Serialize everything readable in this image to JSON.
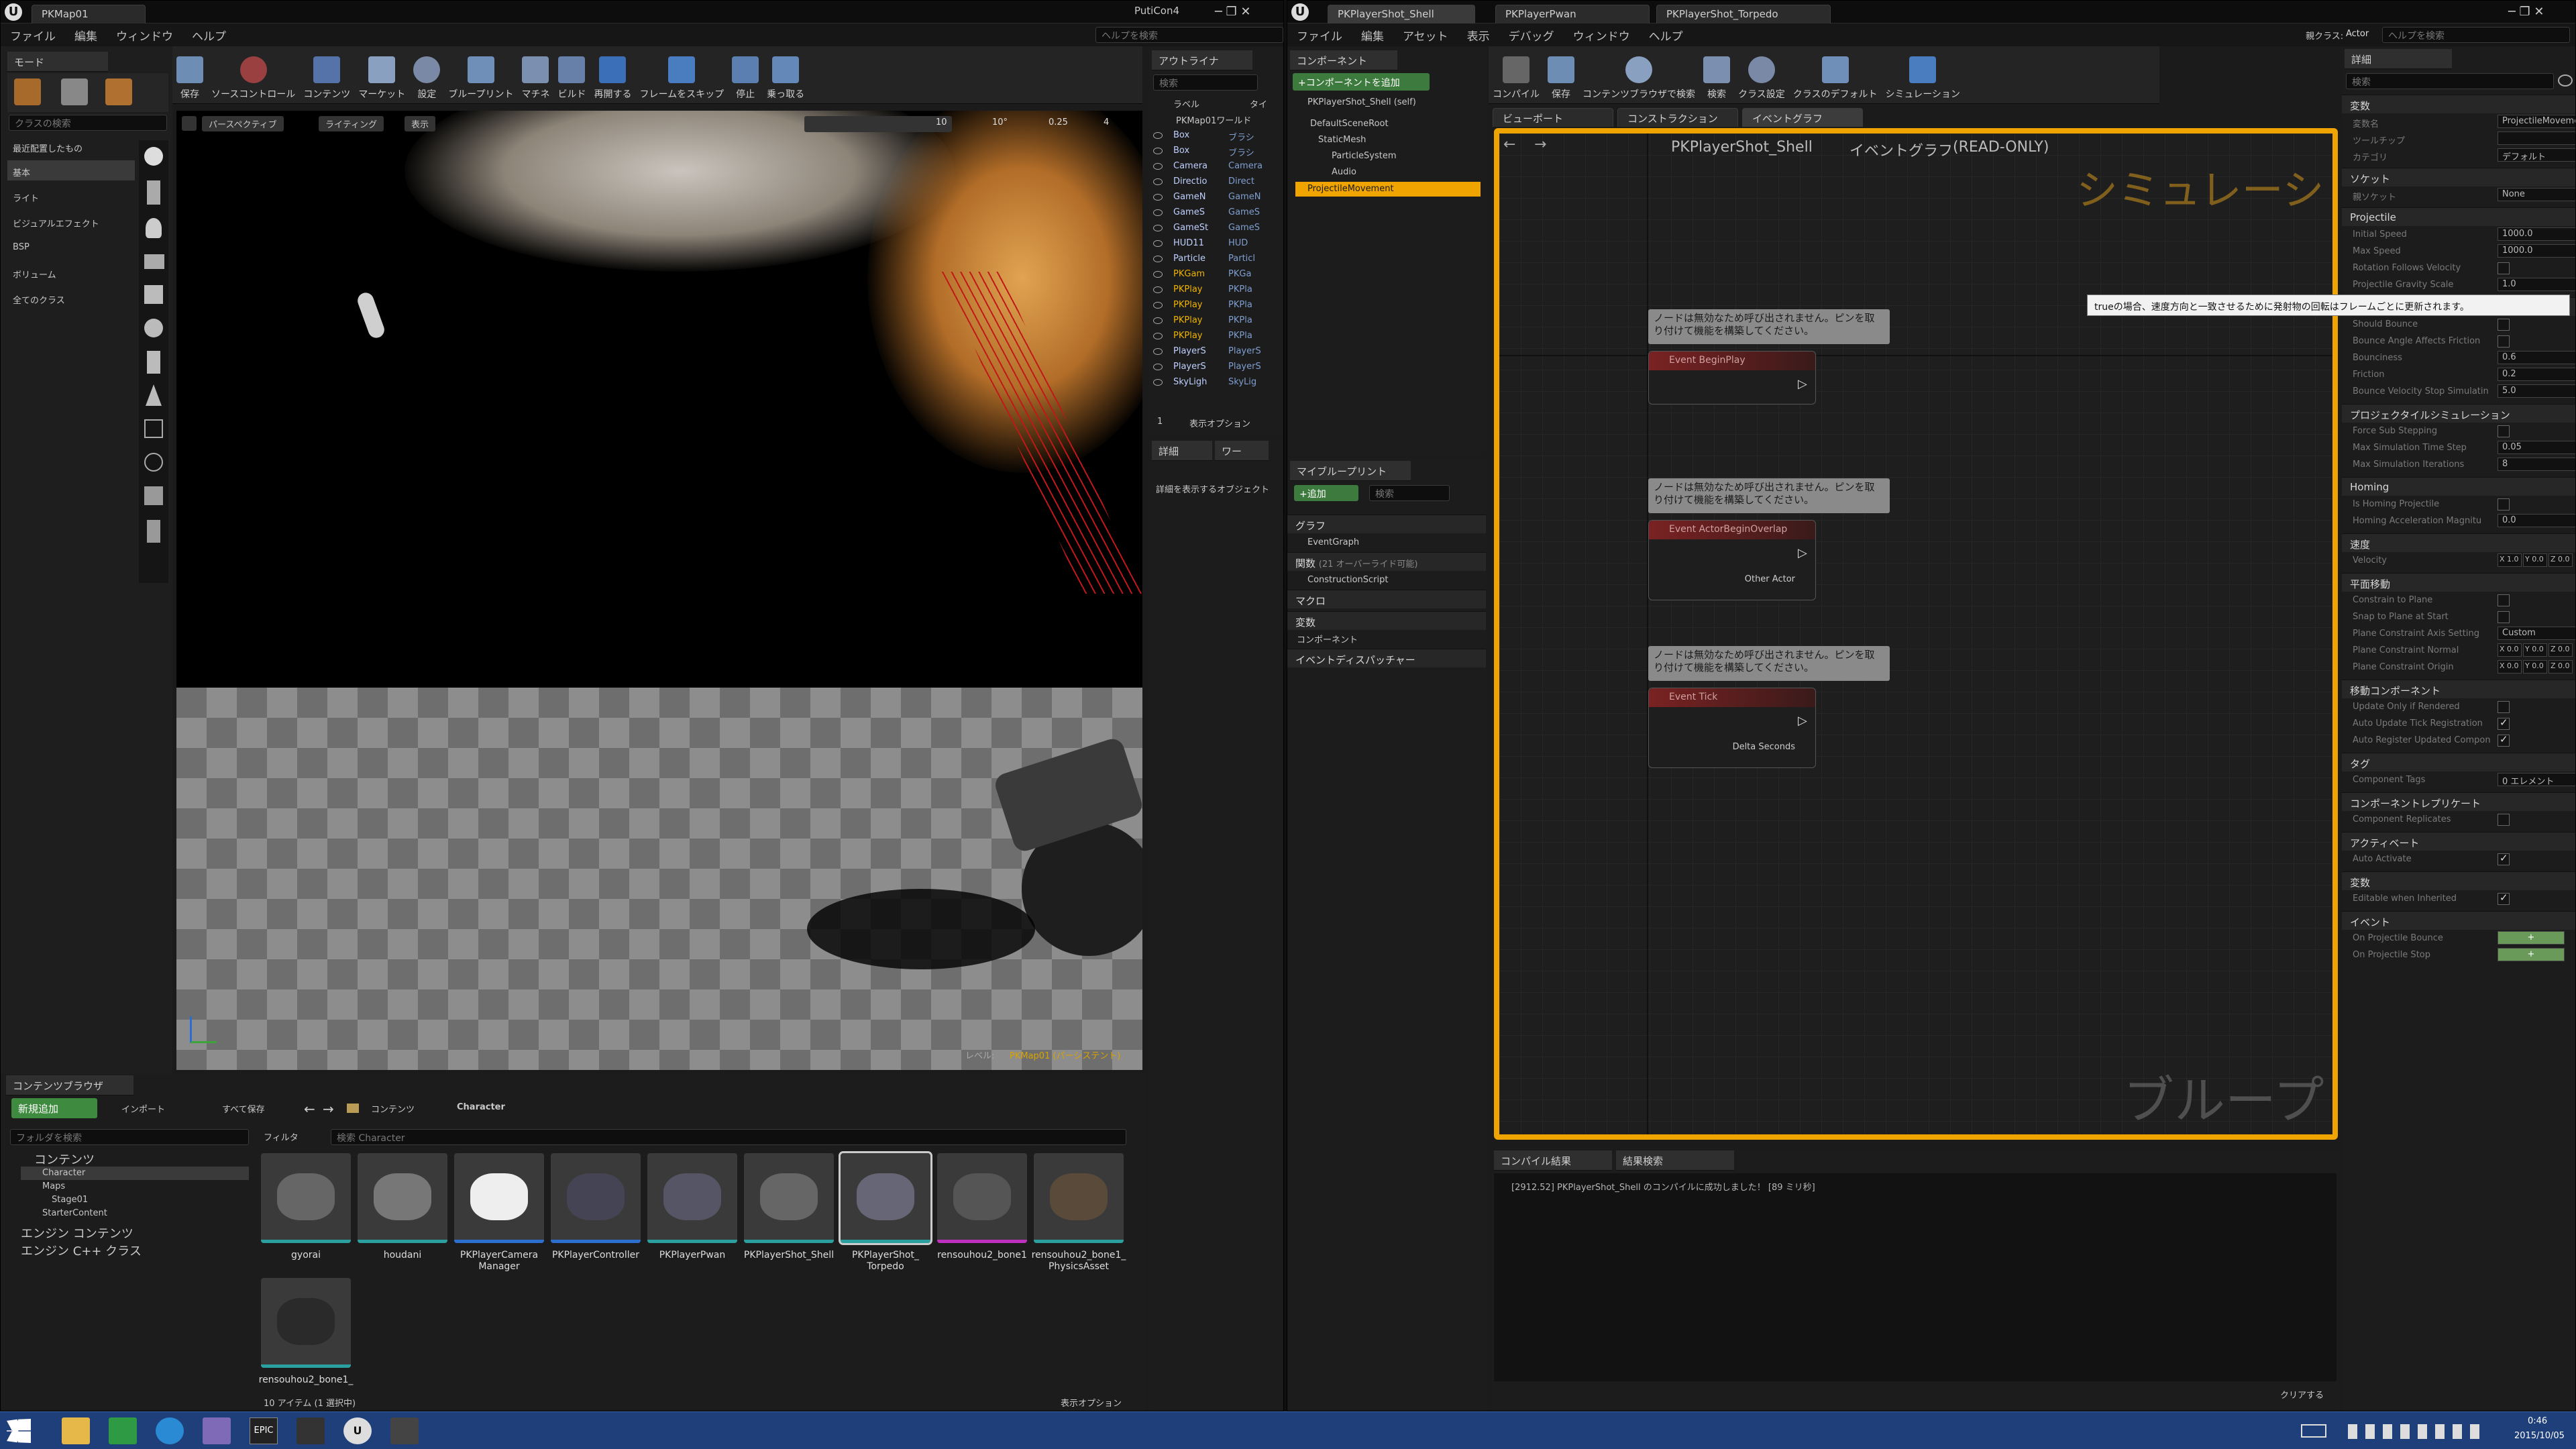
{
  "left_editor": {
    "tab_title": "PKMap01",
    "window_title": "PutiCon4",
    "search_help": "ヘルプを検索",
    "menu": [
      "ファイル",
      "編集",
      "ウィンドウ",
      "ヘルプ"
    ],
    "modes_tab": "モード",
    "class_search_placeholder": "クラスの検索",
    "place_categories": [
      "最近配置したもの",
      "基本",
      "ライト",
      "ビジュアルエフェクト",
      "BSP",
      "ボリューム",
      "全てのクラス"
    ],
    "toolbar": [
      "保存",
      "ソースコントロール",
      "コンテンツ",
      "マーケット",
      "設定",
      "ブループリント",
      "マチネ",
      "ビルド",
      "再開する",
      "フレームをスキップ",
      "停止",
      "乗っ取る"
    ],
    "viewport": {
      "perspective": "パースペクティブ",
      "lighting": "ライティング",
      "show": "表示",
      "grid_size": "10",
      "rot_snap": "10°",
      "scale_snap": "0.25",
      "cam_speed": "4",
      "level_label": "レベル:",
      "level_name": "PKMap01 (パーシステント)"
    },
    "outliner": {
      "tab": "アウトライナ",
      "search": "検索",
      "col_label": "ラベル",
      "col_type": "タイ",
      "root": "PKMap01ワールド",
      "items": [
        {
          "name": "Box",
          "type": "ブラシ"
        },
        {
          "name": "Box",
          "type": "ブラシ"
        },
        {
          "name": "Camera",
          "type": "Camera"
        },
        {
          "name": "Directio",
          "type": "Direct"
        },
        {
          "name": "GameN",
          "type": "GameN"
        },
        {
          "name": "GameS",
          "type": "GameS"
        },
        {
          "name": "GameSt",
          "type": "GameS"
        },
        {
          "name": "HUD11",
          "type": "HUD"
        },
        {
          "name": "Particle",
          "type": "Particl"
        },
        {
          "name": "PKGam",
          "type": "PKGa"
        },
        {
          "name": "PKPlay",
          "type": "PKPla"
        },
        {
          "name": "PKPlay",
          "type": "PKPla"
        },
        {
          "name": "PKPlay",
          "type": "PKPla"
        },
        {
          "name": "PKPlay",
          "type": "PKPla"
        },
        {
          "name": "PlayerS",
          "type": "PlayerS"
        },
        {
          "name": "PlayerS",
          "type": "PlayerS"
        },
        {
          "name": "SkyLigh",
          "type": "SkyLig"
        }
      ],
      "count": "1",
      "view_options": "表示オプション"
    },
    "details": {
      "tab": "詳細",
      "tab2": "ワー",
      "empty": "詳細を表示するオブジェクト"
    },
    "content_browser": {
      "tab": "コンテンツブラウザ",
      "add_new": "新規追加",
      "import": "インポート",
      "save_all": "すべて保存",
      "path": [
        "コンテンツ",
        "Character"
      ],
      "folder_search": "フォルダを検索",
      "filter": "フィルタ",
      "asset_search": "検索 Character",
      "tree": [
        "コンテンツ",
        "Character",
        "Maps",
        "Stage01",
        "StarterContent",
        "エンジン コンテンツ",
        "エンジン C++ クラス"
      ],
      "assets": [
        "gyorai",
        "houdani",
        "PKPlayerCamera Manager",
        "PKPlayerController",
        "PKPlayerPwan",
        "PKPlayerShot_Shell",
        "PKPlayerShot_ Torpedo",
        "rensouhou2_bone1",
        "rensouhou2_bone1_ PhysicsAsset",
        "rensouhou2_bone1_"
      ],
      "status": "10 アイテム (1 選択中)",
      "view_options": "表示オプション"
    }
  },
  "bp_editor": {
    "tabs": [
      "PKPlayerShot_Shell",
      "PKPlayerPwan",
      "PKPlayerShot_Torpedo"
    ],
    "menu": [
      "ファイル",
      "編集",
      "アセット",
      "表示",
      "デバッグ",
      "ウィンドウ",
      "ヘルプ"
    ],
    "parent_class_label": "親クラス:",
    "parent_class": "Actor",
    "search_help": "ヘルプを検索",
    "toolbar": [
      "コンパイル",
      "保存",
      "コンテンツブラウザで検索",
      "検索",
      "クラス設定",
      "クラスのデフォルト",
      "シミュレーション"
    ],
    "components": {
      "tab": "コンポーネント",
      "add": "+コンポーネントを追加",
      "self": "PKPlayerShot_Shell (self)",
      "tree": [
        "DefaultSceneRoot",
        "StaticMesh",
        "ParticleSystem",
        "Audio",
        "ProjectileMovement"
      ]
    },
    "my_blueprint": {
      "tab": "マイブループリント",
      "add": "+追加",
      "search": "検索",
      "sections": {
        "graphs": "グラフ",
        "event_graph": "EventGraph",
        "functions": "関数",
        "overridable": "(21 オーバーライド可能)",
        "construction": "ConstructionScript",
        "macros": "マクロ",
        "variables": "変数",
        "components": "コンポーネント",
        "dispatchers": "イベントディスパッチャー"
      }
    },
    "graph_tabs": [
      "ビューポート",
      "コンストラクション",
      "イベントグラフ"
    ],
    "graph": {
      "breadcrumb": "PKPlayerShot_Shell",
      "graph_name": "イベントグラフ",
      "readonly": "(READ-ONLY)",
      "sim_banner": "シミュレーション中",
      "watermark": "ブループリント",
      "nodes": [
        {
          "note": "ノードは無効なため呼び出されません。ピンを取り付けて機能を構築してください。",
          "title": "Event BeginPlay",
          "pin": ""
        },
        {
          "note": "ノードは無効なため呼び出されません。ピンを取り付けて機能を構築してください。",
          "title": "Event ActorBeginOverlap",
          "pin": "Other Actor"
        },
        {
          "note": "ノードは無効なため呼び出されません。ピンを取り付けて機能を構築してください。",
          "title": "Event Tick",
          "pin": "Delta Seconds"
        }
      ]
    },
    "compiler": {
      "tab": "コンパイル結果",
      "tab2": "結果検索",
      "message": "[2912.52] PKPlayerShot_Shell のコンパイルに成功しました！ [89 ミリ秒]",
      "clear": "クリアする"
    }
  },
  "details_panel": {
    "tab": "詳細",
    "search": "検索",
    "tooltip": "trueの場合、速度方向と一致させるために発射物の回転はフレームごとに更新されます。",
    "sections": [
      {
        "title": "変数",
        "props": [
          {
            "name": "変数名",
            "value": "ProjectileMovement"
          },
          {
            "name": "ツールチップ",
            "value": ""
          },
          {
            "name": "カテゴリ",
            "value": "デフォルト"
          }
        ]
      },
      {
        "title": "ソケット",
        "props": [
          {
            "name": "親ソケット",
            "value": "None"
          }
        ]
      },
      {
        "title": "Projectile",
        "props": [
          {
            "name": "Initial Speed",
            "value": "1000.0"
          },
          {
            "name": "Max Speed",
            "value": "1000.0"
          },
          {
            "name": "Rotation Follows Velocity",
            "check": false
          },
          {
            "name": "Projectile Gravity Scale",
            "value": "1.0"
          }
        ]
      },
      {
        "title": "跳ね返り",
        "props": [
          {
            "name": "Should Bounce",
            "check": false
          },
          {
            "name": "Bounce Angle Affects Friction",
            "check": false
          },
          {
            "name": "Bounciness",
            "value": "0.6"
          },
          {
            "name": "Friction",
            "value": "0.2"
          },
          {
            "name": "Bounce Velocity Stop Simulatin",
            "value": "5.0"
          }
        ]
      },
      {
        "title": "プロジェクタイルシミュレーション",
        "props": [
          {
            "name": "Force Sub Stepping",
            "check": false
          },
          {
            "name": "Max Simulation Time Step",
            "value": "0.05"
          },
          {
            "name": "Max Simulation Iterations",
            "value": "8"
          }
        ]
      },
      {
        "title": "Homing",
        "props": [
          {
            "name": "Is Homing Projectile",
            "check": false
          },
          {
            "name": "Homing Acceleration Magnitu",
            "value": "0.0"
          }
        ]
      },
      {
        "title": "速度",
        "props": [
          {
            "name": "Velocity",
            "vec": [
              "X 1.0",
              "Y 0.0",
              "Z 0.0"
            ]
          }
        ]
      },
      {
        "title": "平面移動",
        "props": [
          {
            "name": "Constrain to Plane",
            "check": false
          },
          {
            "name": "Snap to Plane at Start",
            "check": false
          },
          {
            "name": "Plane Constraint Axis Setting",
            "value": "Custom"
          },
          {
            "name": "Plane Constraint Normal",
            "vec": [
              "X 0.0",
              "Y 0.0",
              "Z 0.0"
            ]
          },
          {
            "name": "Plane Constraint Origin",
            "vec": [
              "X 0.0",
              "Y 0.0",
              "Z 0.0"
            ]
          }
        ]
      },
      {
        "title": "移動コンポーネント",
        "props": [
          {
            "name": "Update Only if Rendered",
            "check": false
          },
          {
            "name": "Auto Update Tick Registration",
            "check": true
          },
          {
            "name": "Auto Register Updated Compon",
            "check": true
          }
        ]
      },
      {
        "title": "タグ",
        "props": [
          {
            "name": "Component Tags",
            "value": "0 エレメント"
          }
        ]
      },
      {
        "title": "コンポーネントレプリケート",
        "props": [
          {
            "name": "Component Replicates",
            "check": false
          }
        ]
      },
      {
        "title": "アクティベート",
        "props": [
          {
            "name": "Auto Activate",
            "check": true
          }
        ]
      },
      {
        "title": "変数",
        "props": [
          {
            "name": "Editable when Inherited",
            "check": true
          }
        ]
      },
      {
        "title": "イベント",
        "props": [
          {
            "name": "On Projectile Bounce",
            "button": "+"
          },
          {
            "name": "On Projectile Stop",
            "button": "+"
          }
        ]
      }
    ]
  },
  "taskbar": {
    "time": "0:46",
    "date": "2015/10/05",
    "app_label": "EPIC"
  },
  "colors": {
    "selection": "#f0a400",
    "taskbar": "#1f3f7a",
    "node_red": "#b33333",
    "accent_blue": "#2f6fb5"
  }
}
